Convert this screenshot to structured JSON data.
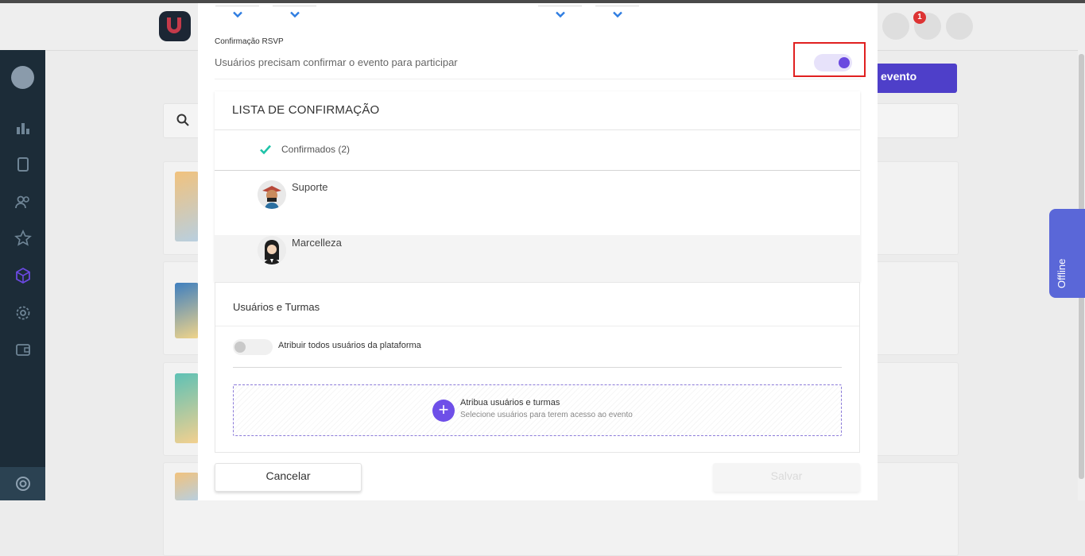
{
  "background": {
    "new_event_label": "evento",
    "notification_count": "1",
    "offline_label": "Offline"
  },
  "modal": {
    "rsvp": {
      "label": "Confirmação RSVP",
      "description": "Usuários precisam confirmar o evento para participar",
      "enabled": true
    },
    "confirmation_list": {
      "title": "LISTA DE CONFIRMAÇÃO",
      "confirmed_label": "Confirmados (2)",
      "users": [
        {
          "name": "Suporte"
        },
        {
          "name": "Marcelleza"
        }
      ]
    },
    "users_and_classes": {
      "title": "Usuários e Turmas",
      "assign_all_label": "Atribuir todos usuários da plataforma",
      "assign_all_enabled": false,
      "dropzone_title": "Atribua usuários e turmas",
      "dropzone_subtitle": "Selecione usuários para terem acesso ao evento"
    },
    "footer": {
      "cancel_label": "Cancelar",
      "save_label": "Salvar"
    }
  },
  "colors": {
    "accent": "#6a49e0",
    "primary_button": "#4e3fc9",
    "highlight": "#e02020",
    "check": "#1ec3a8"
  }
}
